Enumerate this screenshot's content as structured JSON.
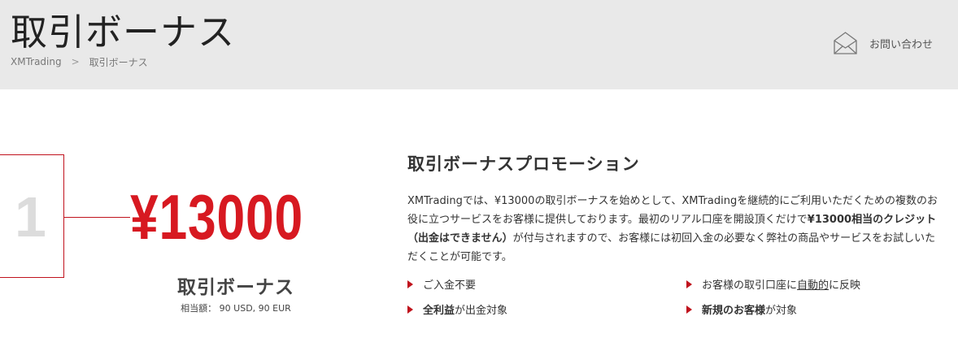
{
  "header": {
    "title": "取引ボーナス",
    "breadcrumb": [
      "XMTrading",
      "取引ボーナス"
    ],
    "breadcrumb_separator": ">",
    "contact_label": "お問い合わせ",
    "contact_icon": "envelope-icon"
  },
  "bonus": {
    "number": "1",
    "amount": "¥13000",
    "label": "取引ボーナス",
    "equivalent": "相当額： 90 USD, 90 EUR",
    "accent_color": "#d71921"
  },
  "promo": {
    "title": "取引ボーナスプロモーション",
    "text_1": "XMTradingでは、¥13000の取引ボーナスを始めとして、XMTradingを継続的にご利用いただくための複数のお役に立つサービスをお客様に提供しております。最初のリアル口座を開設頂くだけで",
    "text_bold": "¥13000相当のクレジット（出金はできません）",
    "text_2": "が付与されますので、お客様には初回入金の必要なく弊社の商品やサービスをお試しいただくことが可能です。"
  },
  "features": {
    "f1": "ご入金不要",
    "f2_bold": "全利益",
    "f2_rest": "が出金対象",
    "f3_pre": "お客様の取引口座に",
    "f3_underline": "自動的",
    "f3_post": "に反映",
    "f4_bold": "新規のお客様",
    "f4_rest": "が対象"
  }
}
